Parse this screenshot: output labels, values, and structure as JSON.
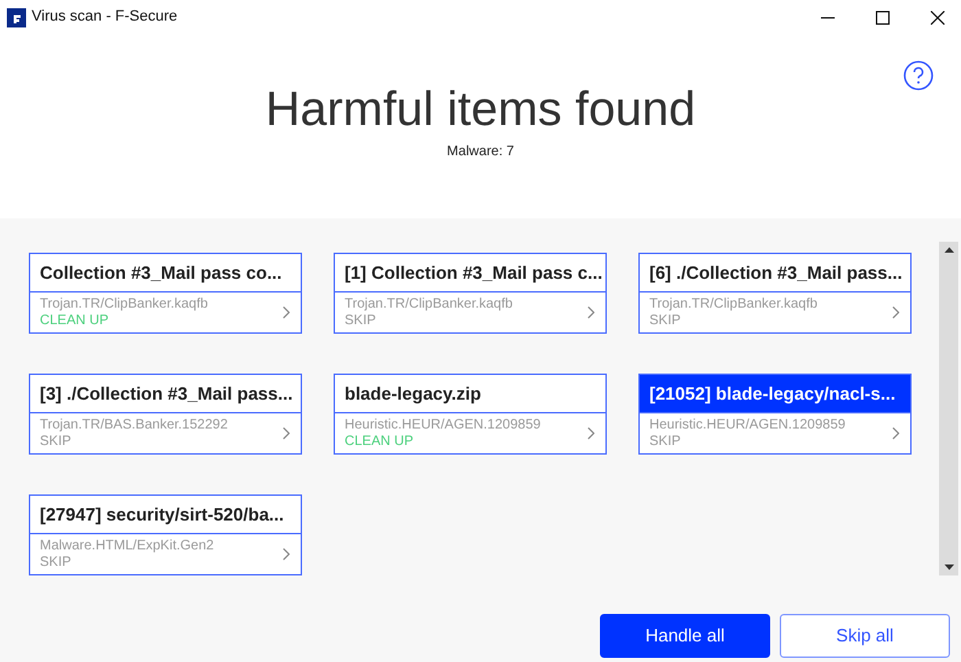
{
  "window": {
    "title": "Virus scan - F-Secure"
  },
  "header": {
    "title": "Harmful items found",
    "subtitle": "Malware: 7"
  },
  "items": [
    {
      "name": "Collection #3_Mail pass co...",
      "detection": "Trojan.TR/ClipBanker.kaqfb",
      "action": "CLEAN UP",
      "kind": "clean",
      "selected": false
    },
    {
      "name": "[1] Collection #3_Mail pass c...",
      "detection": "Trojan.TR/ClipBanker.kaqfb",
      "action": "SKIP",
      "kind": "skip",
      "selected": false
    },
    {
      "name": "[6] ./Collection #3_Mail pass...",
      "detection": "Trojan.TR/ClipBanker.kaqfb",
      "action": "SKIP",
      "kind": "skip",
      "selected": false
    },
    {
      "name": "[3] ./Collection #3_Mail pass...",
      "detection": "Trojan.TR/BAS.Banker.152292",
      "action": "SKIP",
      "kind": "skip",
      "selected": false
    },
    {
      "name": "blade-legacy.zip",
      "detection": "Heuristic.HEUR/AGEN.1209859",
      "action": "CLEAN UP",
      "kind": "clean",
      "selected": false
    },
    {
      "name": "[21052] blade-legacy/nacl-s...",
      "detection": "Heuristic.HEUR/AGEN.1209859",
      "action": "SKIP",
      "kind": "skip",
      "selected": true
    },
    {
      "name": "[27947] security/sirt-520/ba...",
      "detection": "Malware.HTML/ExpKit.Gen2",
      "action": "SKIP",
      "kind": "skip",
      "selected": false
    }
  ],
  "buttons": [
    {
      "label": "Handle all",
      "kind": "primary"
    },
    {
      "label": "Skip all",
      "kind": "secondary"
    }
  ]
}
